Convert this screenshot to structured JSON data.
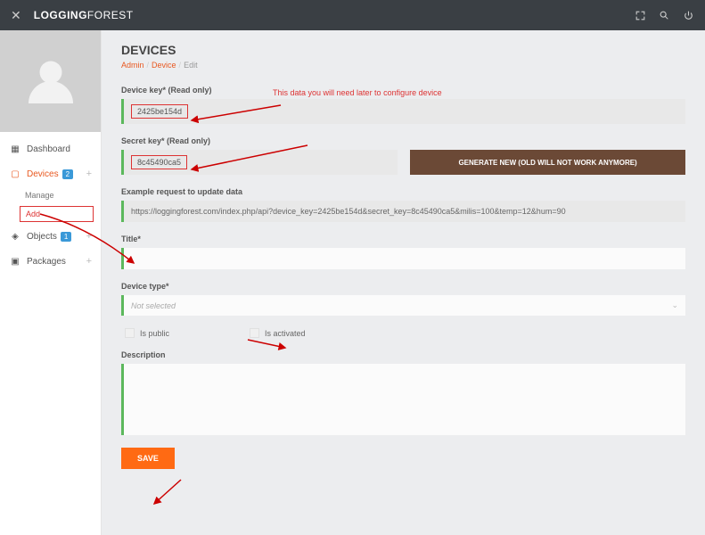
{
  "brand": {
    "prefix": "LOGGING",
    "suffix": "FOREST"
  },
  "sidebar": {
    "items": [
      {
        "label": "Dashboard"
      },
      {
        "label": "Devices",
        "badge": "2"
      },
      {
        "label": "Objects",
        "badge": "1"
      },
      {
        "label": "Packages"
      }
    ],
    "sub": {
      "manage": "Manage",
      "add": "Add"
    }
  },
  "page": {
    "title": "DEVICES",
    "crumb_admin": "Admin",
    "crumb_device": "Device",
    "crumb_edit": "Edit"
  },
  "fields": {
    "device_key_label": "Device key* (Read only)",
    "device_key_value": "2425be154d",
    "note": "This data you will need later to configure device",
    "secret_key_label": "Secret key* (Read only)",
    "secret_key_value": "8c45490ca5",
    "generate_btn": "GENERATE NEW (OLD WILL NOT WORK ANYMORE)",
    "example_label": "Example request to update data",
    "example_value": "https://loggingforest.com/index.php/api?device_key=2425be154d&secret_key=8c45490ca5&milis=100&temp=12&hum=90",
    "title_label": "Title*",
    "type_label": "Device type*",
    "type_placeholder": "Not selected",
    "is_public": "Is public",
    "is_activated": "Is activated",
    "desc_label": "Description",
    "save": "SAVE"
  }
}
